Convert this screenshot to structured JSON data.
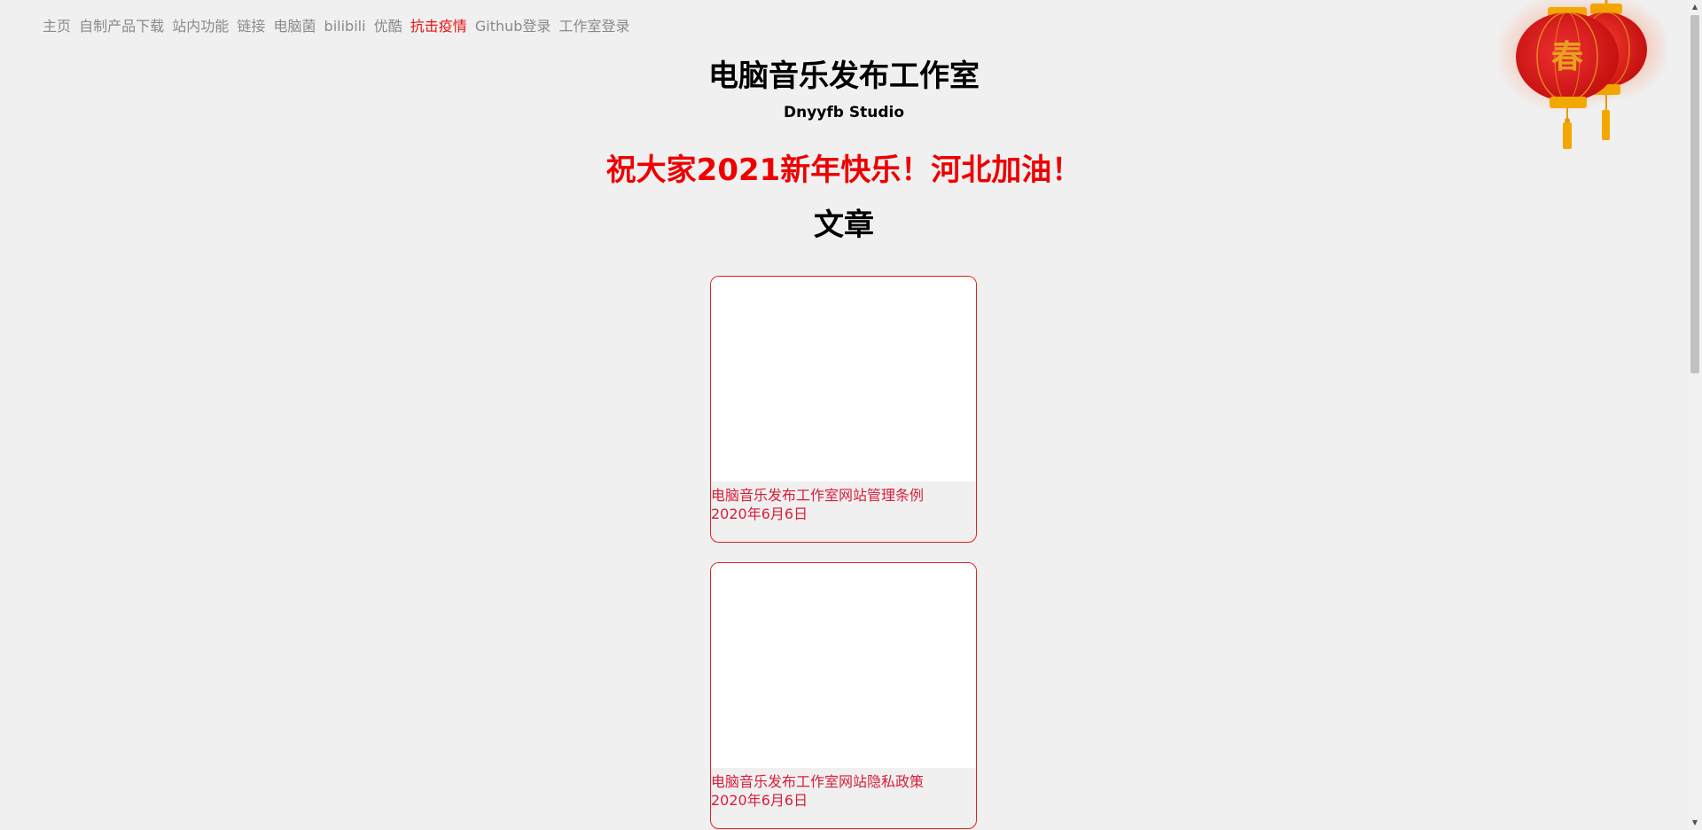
{
  "nav": {
    "items": [
      {
        "label": "主页"
      },
      {
        "label": "自制产品下载"
      },
      {
        "label": "站内功能"
      },
      {
        "label": "链接"
      },
      {
        "label": "电脑菌"
      },
      {
        "label": "bilibili"
      },
      {
        "label": "优酷"
      },
      {
        "label": "抗击疫情"
      },
      {
        "label": "Github登录"
      },
      {
        "label": "工作室登录"
      }
    ],
    "highlight_color": "#e81010"
  },
  "header": {
    "title": "电脑音乐发布工作室",
    "subtitle": "Dnyyfb Studio",
    "greeting": "祝大家2021新年快乐！河北加油！",
    "greeting_color": "#ee0000"
  },
  "articles": {
    "section_title": "文章",
    "items": [
      {
        "title": "电脑音乐发布工作室网站管理条例",
        "date": "2020年6月6日"
      },
      {
        "title": "电脑音乐发布工作室网站隐私政策",
        "date": "2020年6月6日"
      }
    ],
    "accent_color": "#d81e3a"
  },
  "decoration": {
    "lantern_text": "春",
    "icon": "lantern-icon"
  }
}
